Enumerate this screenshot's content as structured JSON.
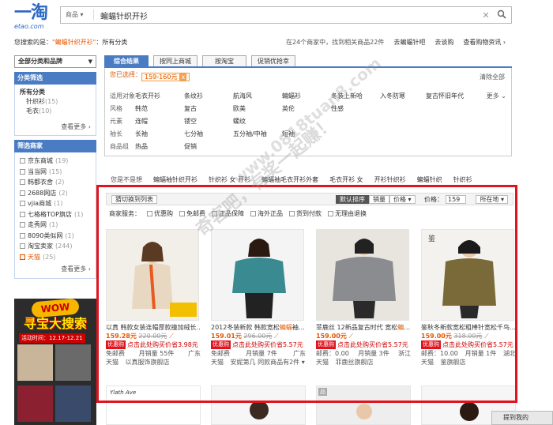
{
  "logo": {
    "main": "一淘",
    "domain": "etao.com"
  },
  "search": {
    "category": "商品",
    "query": "蝙蝠针织开衫",
    "clear": "✕",
    "go": "🔍"
  },
  "crumb": {
    "prefix": "您搜索的是：",
    "keyword": "\"蝙蝠针织开衫\"",
    "suffix": "：所有分类"
  },
  "toplinks": [
    "在24个商家中，找到相关商品22件",
    "去蝙蝠针吧",
    "去谈购",
    "查看购物资讯 ›"
  ],
  "sidebar": {
    "catsel": "全部分类和品牌",
    "cat_head": "分类筛选",
    "cat_all": "所有分类",
    "cats": [
      {
        "name": "针织衫",
        "cnt": "(15)"
      },
      {
        "name": "毛衣",
        "cnt": "(10)"
      }
    ],
    "cat_more": "查看更多 ›",
    "shop_head": "筛选商家",
    "shops": [
      {
        "name": "京东商城",
        "cnt": "(19)",
        "on": false
      },
      {
        "name": "当当网",
        "cnt": "(15)",
        "on": false
      },
      {
        "name": "韩都衣舍",
        "cnt": "(2)",
        "on": false
      },
      {
        "name": "2688网店",
        "cnt": "(2)",
        "on": false
      },
      {
        "name": "vjia商城",
        "cnt": "(1)",
        "on": false
      },
      {
        "name": "七格格TOP旗店",
        "cnt": "(1)",
        "on": false
      },
      {
        "name": "走秀网",
        "cnt": "(1)",
        "on": false
      },
      {
        "name": "8090类似网",
        "cnt": "(1)",
        "on": false
      },
      {
        "name": "淘宝卖家",
        "cnt": "(244)",
        "on": false
      },
      {
        "name": "天猫",
        "cnt": "(25)",
        "on": true
      }
    ],
    "shop_more": "查看更多 ›"
  },
  "ad": {
    "wow": "WOW",
    "title": "寻宝大搜索",
    "date": "活动时间：12.17-12.21"
  },
  "tabs": [
    "综合结果",
    "按同上商城",
    "按淘宝",
    "促销优抢幸"
  ],
  "filter": {
    "selected_label": "您已选择：",
    "tag": "159-160元",
    "tag_x": "x",
    "clear": "清除全部",
    "more": "更多 ⌄",
    "rows": [
      {
        "label": "适用对象",
        "values": [
          "毛衣开衫",
          "条纹衫",
          "航海风",
          "蝙蝠衫",
          "冬装上新哈",
          "入冬防寒",
          "复古怀旧年代"
        ]
      },
      {
        "label": "风格",
        "values": [
          "韩范",
          "复古",
          "欧美",
          "英伦",
          "性感"
        ]
      },
      {
        "label": "元素",
        "values": [
          "连帽",
          "镂空",
          "螺纹"
        ]
      },
      {
        "label": "袖长",
        "values": [
          "长袖",
          "七分袖",
          "五分袖/中袖",
          "短袖"
        ]
      },
      {
        "label": "商品组",
        "values": [
          "热品",
          "促销"
        ]
      }
    ]
  },
  "related": [
    "您是不是想",
    "蝙蝠袖针织开衫",
    "针织衫 女 开衫",
    "蝙蝠袖毛衣开衫外套",
    "毛衣开衫 女",
    "开衫针织衫",
    "蝙蝠针织",
    "针织衫"
  ],
  "sortbar": {
    "switch": "猜切换到列表",
    "sorts": [
      "默认排序",
      "销量",
      "价格 ▾"
    ],
    "price_label": "价格：",
    "price_value": "159",
    "loc": "所在地 ▾"
  },
  "services": {
    "label": "商家服务：",
    "items": [
      "优惠购",
      "免邮费",
      "正品保障",
      "海外正品",
      "货到付款",
      "无理由退换"
    ]
  },
  "products": [
    {
      "title": "以真 韩款女装连帽厚款撞加绒长…",
      "hl": "",
      "price": "159.28元",
      "old": "220.00元",
      "promo_badge": "优惠购",
      "promo": "点击此处购买价省3.98元",
      "ship": "免邮费",
      "sales": "月销量 55件",
      "loc": "广东",
      "store_type": "天猫",
      "store": "以真服饰旗舰店"
    },
    {
      "title": "2012冬装新款 韩款宽松",
      "hl": "蝙蝠",
      "title2": "袖…",
      "price": "159.01元",
      "old": "296.00元",
      "promo_badge": "优惠购",
      "promo": "点击此处购买价省5.57元",
      "ship": "免邮费",
      "sales": "月销量 7件",
      "loc": "广东",
      "store_type": "天猫",
      "store": "安妮第几 同款商品有2件 ▾"
    },
    {
      "title": "菲鹿丝 12新品复古时代 宽松",
      "hl": "蝙",
      "title2": "…",
      "price": "159.00元",
      "old": "",
      "promo_badge": "优惠购",
      "promo": "点击此处购买价省5.57元",
      "ship": "邮费：0.00",
      "sales": "月销量 3件",
      "loc": "浙江",
      "store_type": "天猫",
      "store": "菲鹿丝旗舰店"
    },
    {
      "title": "鉴秋冬新款宽松粗棒针宽松千鸟…",
      "hl": "",
      "price": "159.00元",
      "old": "318.00元",
      "promo_badge": "优惠购",
      "promo": "点击此处购买价省5.57元",
      "ship": "邮费：10.00",
      "sales": "月销量 1件",
      "loc": "湖北",
      "store_type": "天猫",
      "store": "鉴旗舰店"
    }
  ],
  "row2_brand": "Ylath Ave",
  "row2_tag": "品",
  "watermark1": "奇客吧，有奖一起赚！",
  "watermark2": "www.0818tuan8.com",
  "feedback": "提到我的",
  "colors": {
    "accent": "#4a7cc4",
    "highlight": "#e45600",
    "redbox": "#e0141e"
  }
}
